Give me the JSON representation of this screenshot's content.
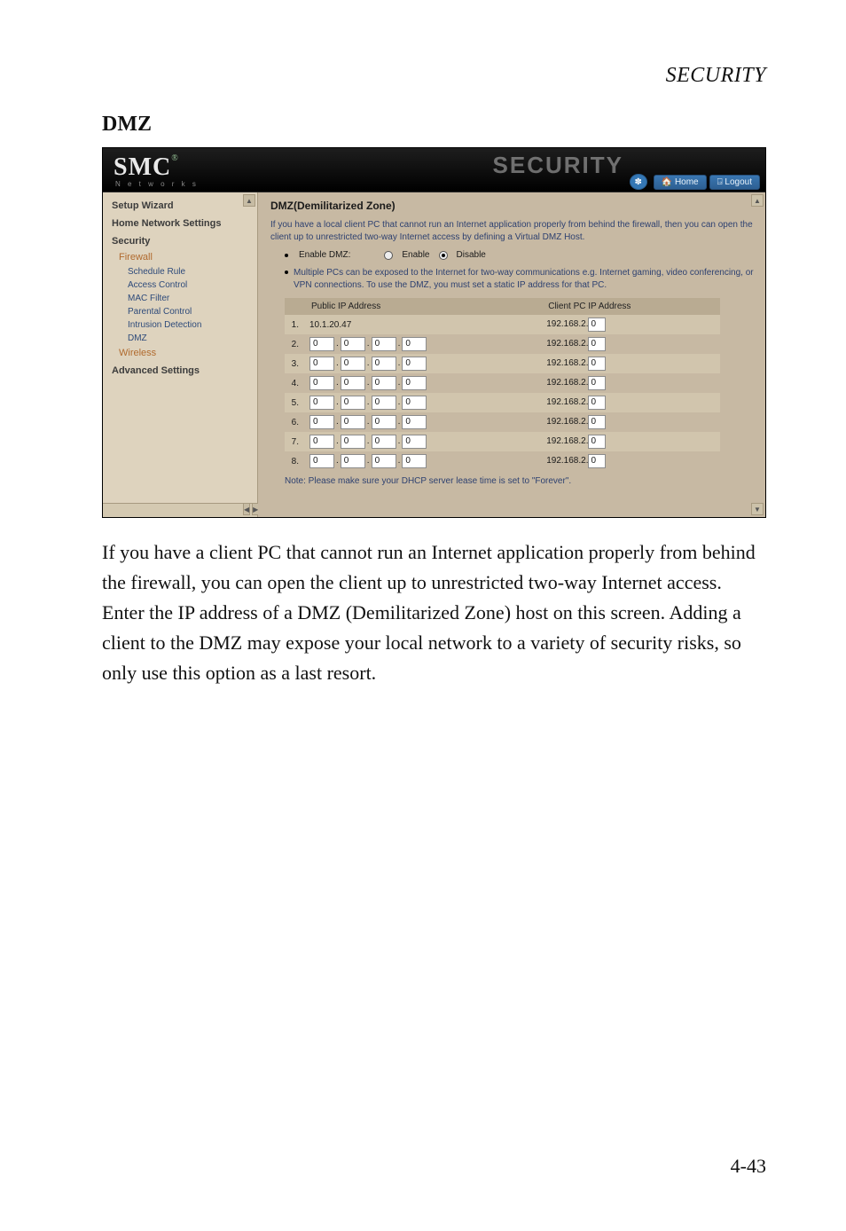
{
  "page": {
    "running_head": "SECURITY",
    "section_title": "DMZ",
    "body_paragraph": "If you have a client PC that cannot run an Internet application properly from behind the firewall, you can open the client up to unrestricted two-way Internet access. Enter the IP address of a DMZ (Demilitarized Zone) host on this screen. Adding a client to the DMZ may expose your local network to a variety of security risks, so only use this option as a last resort.",
    "page_number": "4-43"
  },
  "shot": {
    "brand": "SMC",
    "brand_tag": "N e t w o r k s",
    "brand_word": "SECURITY",
    "topbar": {
      "home": "Home",
      "logout": "Logout"
    },
    "nav": {
      "setup_wizard": "Setup Wizard",
      "home_network_settings": "Home Network Settings",
      "security": "Security",
      "firewall": "Firewall",
      "schedule_rule": "Schedule Rule",
      "access_control": "Access Control",
      "mac_filter": "MAC Filter",
      "parental_control": "Parental Control",
      "intrusion_detection": "Intrusion Detection",
      "dmz": "DMZ",
      "wireless": "Wireless",
      "advanced_settings": "Advanced Settings"
    },
    "main": {
      "title": "DMZ(Demilitarized Zone)",
      "intro": "If you have a local client PC that cannot run an Internet application properly from behind the firewall, then you can open the client up to unrestricted two-way Internet access by defining a Virtual DMZ Host.",
      "enable_label": "Enable DMZ:",
      "radio_enable": "Enable",
      "radio_disable": "Disable",
      "radio_selected": "disable",
      "bullet_note": "Multiple PCs can be exposed to the Internet for two-way communications e.g. Internet gaming, video conferencing, or VPN connections.  To use the DMZ, you must set a static IP address for that PC.",
      "col_public": "Public IP Address",
      "col_client": "Client PC IP Address",
      "client_prefix": "192.168.2.",
      "rows": [
        {
          "index": "1.",
          "public_fixed": "10.1.20.47",
          "client_last": "0"
        },
        {
          "index": "2.",
          "octets": [
            "0",
            "0",
            "0",
            "0"
          ],
          "client_last": "0"
        },
        {
          "index": "3.",
          "octets": [
            "0",
            "0",
            "0",
            "0"
          ],
          "client_last": "0"
        },
        {
          "index": "4.",
          "octets": [
            "0",
            "0",
            "0",
            "0"
          ],
          "client_last": "0"
        },
        {
          "index": "5.",
          "octets": [
            "0",
            "0",
            "0",
            "0"
          ],
          "client_last": "0"
        },
        {
          "index": "6.",
          "octets": [
            "0",
            "0",
            "0",
            "0"
          ],
          "client_last": "0"
        },
        {
          "index": "7.",
          "octets": [
            "0",
            "0",
            "0",
            "0"
          ],
          "client_last": "0"
        },
        {
          "index": "8.",
          "octets": [
            "0",
            "0",
            "0",
            "0"
          ],
          "client_last": "0"
        }
      ],
      "footnote": "Note: Please make sure your DHCP server lease time is set to \"Forever\"."
    }
  }
}
